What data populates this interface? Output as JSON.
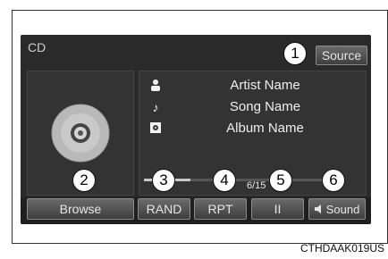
{
  "screen": {
    "title": "CD",
    "source_label": "Source"
  },
  "info": {
    "artist": "Artist Name",
    "song": "Song Name",
    "album": "Album Name",
    "track": "6/15",
    "artist_icon": "person-icon",
    "song_icon": "music-note-icon",
    "album_icon": "album-icon"
  },
  "progress": {
    "fraction": 0.25
  },
  "controls": {
    "browse_label": "Browse",
    "rand_label": "RAND",
    "rpt_label": "RPT",
    "pause_label": "II",
    "sound_label": "Sound"
  },
  "callouts": [
    "1",
    "2",
    "3",
    "4",
    "5",
    "6"
  ],
  "caption": "CTHDAAK019US",
  "colors": {
    "screen_bg": "#2a2a2a",
    "button_text": "#e6e6e6",
    "callout_border": "#111111"
  }
}
